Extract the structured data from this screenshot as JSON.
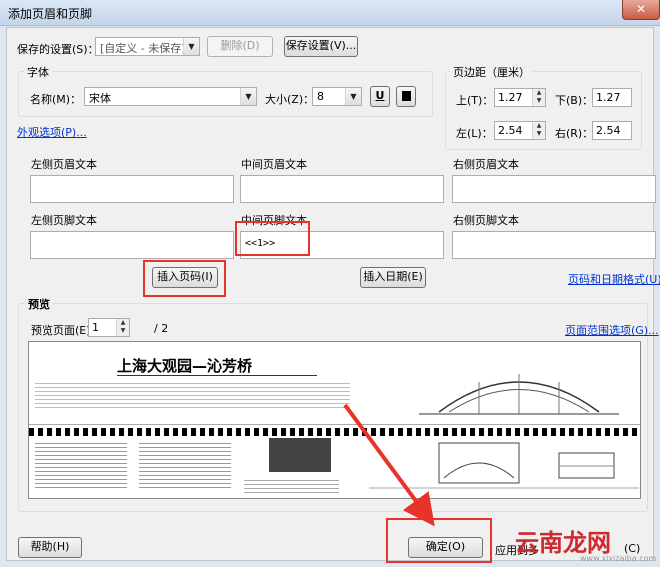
{
  "window": {
    "title": "添加页眉和页脚",
    "close_glyph": "✕"
  },
  "settings": {
    "saved_label": "保存的设置(S)：",
    "saved_value": "[自定义 - 未保存]",
    "delete_label": "删除(D)",
    "save_label": "保存设置(V)..."
  },
  "font": {
    "group_label": "字体",
    "name_label": "名称(M)：",
    "name_value": "宋体",
    "size_label": "大小(Z)：",
    "size_value": "8",
    "underline_glyph": "U"
  },
  "margin": {
    "group_label": "页边距（厘米）",
    "top_label": "上(T)：",
    "top_value": "1.27",
    "bottom_label": "下(B)：",
    "bottom_value": "1.27",
    "left_label": "左(L)：",
    "left_value": "2.54",
    "right_label": "右(R)：",
    "right_value": "2.54"
  },
  "appearance_link": "外观选项(P)...",
  "header_footer": {
    "left_header_label": "左侧页眉文本",
    "center_header_label": "中间页眉文本",
    "right_header_label": "右侧页眉文本",
    "left_footer_label": "左侧页脚文本",
    "center_footer_label": "中间页脚文本",
    "right_footer_label": "右侧页脚文本",
    "center_footer_value": "<<1>>"
  },
  "insert_page_label": "插入页码(I)",
  "insert_date_label": "插入日期(E)",
  "page_date_format_link": "页码和日期格式(U)...",
  "preview": {
    "group_label": "预览",
    "page_label": "预览页面(E)",
    "page_value": "1",
    "page_total": "/ 2",
    "page_range_link": "页面范围选项(G)...",
    "doc_title": "上海大观园—沁芳桥"
  },
  "footer": {
    "help_label": "帮助(H)",
    "ok_label": "确定(O)",
    "apply_label": "应用到多",
    "cancel_partial": "(C)"
  },
  "watermark": {
    "text": "云南龙网",
    "url": "www.xixizaiba.com"
  },
  "colors": {
    "accent_red": "#e8332a",
    "link_blue": "#0033cc"
  }
}
